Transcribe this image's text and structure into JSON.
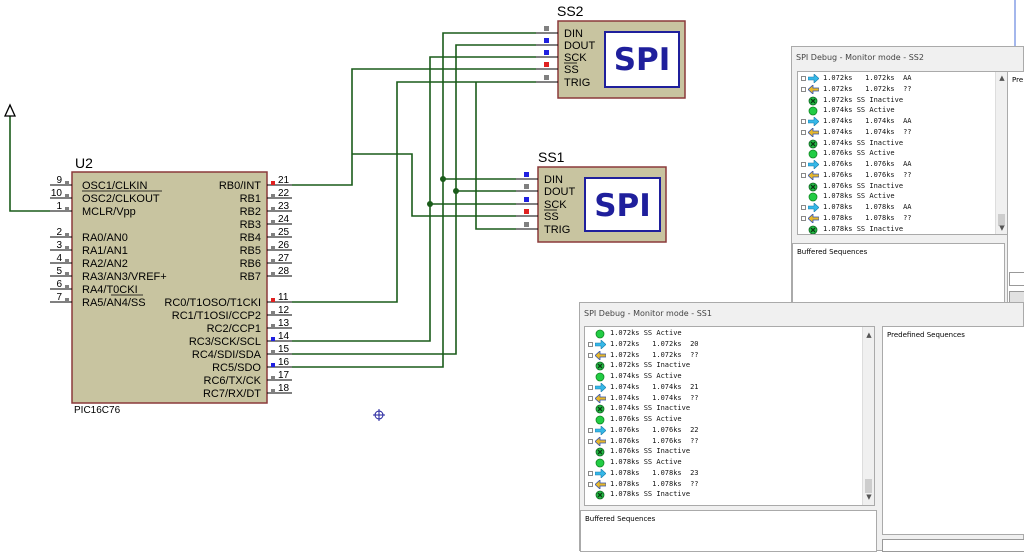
{
  "schematic": {
    "mcu": {
      "ref": "U2",
      "part": "PIC16C76",
      "left_pins": [
        {
          "num": "9",
          "name": "OSC1/CLKIN"
        },
        {
          "num": "10",
          "name": "OSC2/CLKOUT"
        },
        {
          "num": "1",
          "name": "MCLR/Vpp"
        },
        {
          "num": "2",
          "name": "RA0/AN0"
        },
        {
          "num": "3",
          "name": "RA1/AN1"
        },
        {
          "num": "4",
          "name": "RA2/AN2"
        },
        {
          "num": "5",
          "name": "RA3/AN3/VREF+"
        },
        {
          "num": "6",
          "name": "RA4/T0CKI"
        },
        {
          "num": "7",
          "name": "RA5/AN4/SS"
        }
      ],
      "right_pins": [
        {
          "num": "21",
          "name": "RB0/INT"
        },
        {
          "num": "22",
          "name": "RB1"
        },
        {
          "num": "23",
          "name": "RB2"
        },
        {
          "num": "24",
          "name": "RB3"
        },
        {
          "num": "25",
          "name": "RB4"
        },
        {
          "num": "26",
          "name": "RB5"
        },
        {
          "num": "27",
          "name": "RB6"
        },
        {
          "num": "28",
          "name": "RB7"
        },
        {
          "num": "11",
          "name": "RC0/T1OSO/T1CKI"
        },
        {
          "num": "12",
          "name": "RC1/T1OSI/CCP2"
        },
        {
          "num": "13",
          "name": "RC2/CCP1"
        },
        {
          "num": "14",
          "name": "RC3/SCK/SCL"
        },
        {
          "num": "15",
          "name": "RC4/SDI/SDA"
        },
        {
          "num": "16",
          "name": "RC5/SDO"
        },
        {
          "num": "17",
          "name": "RC6/TX/CK"
        },
        {
          "num": "18",
          "name": "RC7/RX/DT"
        }
      ]
    },
    "spi_devices": [
      {
        "ref": "SS2",
        "label": "SPI",
        "pins": [
          "DIN",
          "DOUT",
          "SCK",
          "SS",
          "TRIG"
        ]
      },
      {
        "ref": "SS1",
        "label": "SPI",
        "pins": [
          "DIN",
          "DOUT",
          "SCK",
          "SS",
          "TRIG"
        ]
      }
    ],
    "colors": {
      "wire": "#1a5c1a",
      "component_fill": "#c8c4a0",
      "component_border": "#8b3a3a",
      "spi_text": "#1f1f9c",
      "pin_red": "#e02020",
      "pin_blue": "#2020e0",
      "pin_grey": "#808080"
    }
  },
  "windows": [
    {
      "id": "ss2",
      "title": "SPI Debug - Monitor mode - SS2",
      "rows": [
        {
          "icon": "arrow-right-icon",
          "expand": true,
          "text": "1.072ks   1.072ks  AA"
        },
        {
          "icon": "arrow-left-icon",
          "expand": true,
          "text": "1.072ks   1.072ks  ??"
        },
        {
          "icon": "ss-inactive-icon",
          "expand": false,
          "text": "1.072ks SS Inactive"
        },
        {
          "icon": "ss-active-icon",
          "expand": false,
          "text": "1.074ks SS Active"
        },
        {
          "icon": "arrow-right-icon",
          "expand": true,
          "text": "1.074ks   1.074ks  AA"
        },
        {
          "icon": "arrow-left-icon",
          "expand": true,
          "text": "1.074ks   1.074ks  ??"
        },
        {
          "icon": "ss-inactive-icon",
          "expand": false,
          "text": "1.074ks SS Inactive"
        },
        {
          "icon": "ss-active-icon",
          "expand": false,
          "text": "1.076ks SS Active"
        },
        {
          "icon": "arrow-right-icon",
          "expand": true,
          "text": "1.076ks   1.076ks  AA"
        },
        {
          "icon": "arrow-left-icon",
          "expand": true,
          "text": "1.076ks   1.076ks  ??"
        },
        {
          "icon": "ss-inactive-icon",
          "expand": false,
          "text": "1.076ks SS Inactive"
        },
        {
          "icon": "ss-active-icon",
          "expand": false,
          "text": "1.078ks SS Active"
        },
        {
          "icon": "arrow-right-icon",
          "expand": true,
          "text": "1.078ks   1.078ks  AA"
        },
        {
          "icon": "arrow-left-icon",
          "expand": true,
          "text": "1.078ks   1.078ks  ??"
        },
        {
          "icon": "ss-inactive-icon",
          "expand": false,
          "text": "1.078ks SS Inactive"
        }
      ],
      "buffered_label": "Buffered Sequences",
      "predefined_label": "Pre"
    },
    {
      "id": "ss1",
      "title": "SPI Debug - Monitor mode - SS1",
      "rows": [
        {
          "icon": "ss-active-icon",
          "expand": false,
          "text": "1.072ks SS Active"
        },
        {
          "icon": "arrow-right-icon",
          "expand": true,
          "text": "1.072ks   1.072ks  20"
        },
        {
          "icon": "arrow-left-icon",
          "expand": true,
          "text": "1.072ks   1.072ks  ??"
        },
        {
          "icon": "ss-inactive-icon",
          "expand": false,
          "text": "1.072ks SS Inactive"
        },
        {
          "icon": "ss-active-icon",
          "expand": false,
          "text": "1.074ks SS Active"
        },
        {
          "icon": "arrow-right-icon",
          "expand": true,
          "text": "1.074ks   1.074ks  21"
        },
        {
          "icon": "arrow-left-icon",
          "expand": true,
          "text": "1.074ks   1.074ks  ??"
        },
        {
          "icon": "ss-inactive-icon",
          "expand": false,
          "text": "1.074ks SS Inactive"
        },
        {
          "icon": "ss-active-icon",
          "expand": false,
          "text": "1.076ks SS Active"
        },
        {
          "icon": "arrow-right-icon",
          "expand": true,
          "text": "1.076ks   1.076ks  22"
        },
        {
          "icon": "arrow-left-icon",
          "expand": true,
          "text": "1.076ks   1.076ks  ??"
        },
        {
          "icon": "ss-inactive-icon",
          "expand": false,
          "text": "1.076ks SS Inactive"
        },
        {
          "icon": "ss-active-icon",
          "expand": false,
          "text": "1.078ks SS Active"
        },
        {
          "icon": "arrow-right-icon",
          "expand": true,
          "text": "1.078ks   1.078ks  23"
        },
        {
          "icon": "arrow-left-icon",
          "expand": true,
          "text": "1.078ks   1.078ks  ??"
        },
        {
          "icon": "ss-inactive-icon",
          "expand": false,
          "text": "1.078ks SS Inactive"
        }
      ],
      "buffered_label": "Buffered Sequences",
      "predefined_label": "Predefined Sequences"
    }
  ]
}
